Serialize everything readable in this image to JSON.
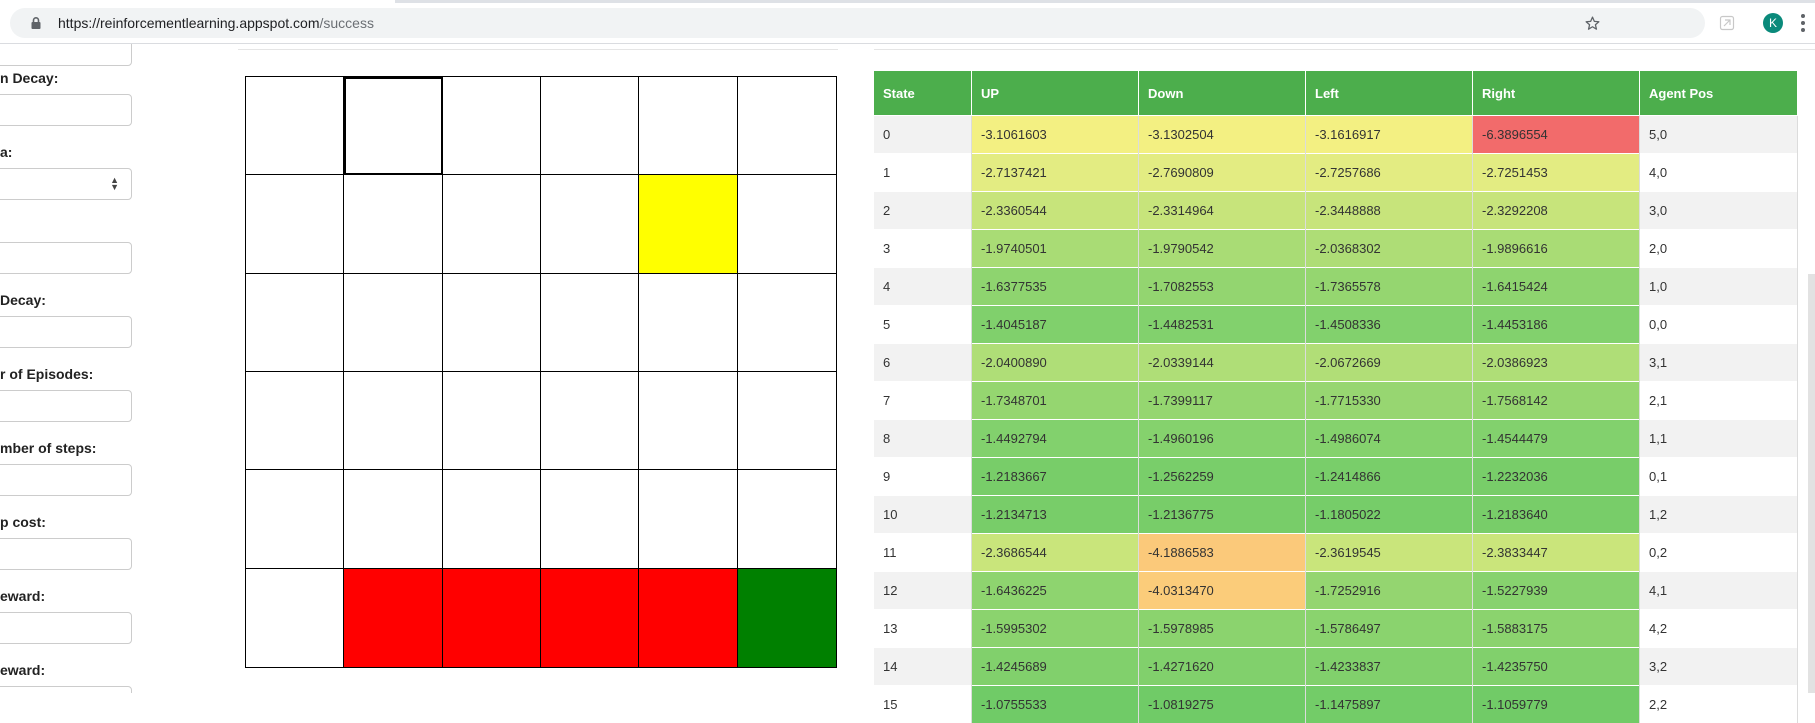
{
  "browser": {
    "url_host": "https://reinforcementlearning.appspot.com",
    "url_path": "/success",
    "profile_initial": "K"
  },
  "form": {
    "labels": [
      "n Decay:",
      "a:",
      "Decay:",
      "r of Episodes:",
      "mber of steps:",
      "p cost:",
      "eward:",
      "eward:"
    ]
  },
  "grid": {
    "rows": 6,
    "cols": 6,
    "current_cell": [
      0,
      1
    ],
    "colored_cells": [
      {
        "row": 1,
        "col": 4,
        "color": "#ffff00"
      },
      {
        "row": 5,
        "col": 1,
        "color": "#ff0000"
      },
      {
        "row": 5,
        "col": 2,
        "color": "#ff0000"
      },
      {
        "row": 5,
        "col": 3,
        "color": "#ff0000"
      },
      {
        "row": 5,
        "col": 4,
        "color": "#ff0000"
      },
      {
        "row": 5,
        "col": 5,
        "color": "#008000"
      }
    ]
  },
  "table": {
    "headers": [
      "State",
      "UP",
      "Down",
      "Left",
      "Right",
      "Agent Pos"
    ],
    "header_color": "#4cae4c",
    "rows": [
      {
        "state": "0",
        "q": [
          "-3.1061603",
          "-3.1302504",
          "-3.1616917",
          "-6.3896554"
        ],
        "colors": [
          "#f3f082",
          "#f3f082",
          "#f3f082",
          "#f26b6b"
        ],
        "pos": "5,0"
      },
      {
        "state": "1",
        "q": [
          "-2.7137421",
          "-2.7690809",
          "-2.7257686",
          "-2.7251453"
        ],
        "colors": [
          "#e3ec82",
          "#e3ec82",
          "#e3ec82",
          "#e3ec82"
        ],
        "pos": "4,0"
      },
      {
        "state": "2",
        "q": [
          "-2.3360544",
          "-2.3314964",
          "-2.3448888",
          "-2.3292208"
        ],
        "colors": [
          "#c7e47b",
          "#c7e47b",
          "#c7e47b",
          "#c7e47b"
        ],
        "pos": "3,0"
      },
      {
        "state": "3",
        "q": [
          "-1.9740501",
          "-1.9790542",
          "-2.0368302",
          "-1.9896616"
        ],
        "colors": [
          "#a9dc75",
          "#a9dc75",
          "#aedd76",
          "#a9dc75"
        ],
        "pos": "2,0"
      },
      {
        "state": "4",
        "q": [
          "-1.6377535",
          "-1.7082553",
          "-1.7365578",
          "-1.6415424"
        ],
        "colors": [
          "#8ed46f",
          "#93d570",
          "#95d670",
          "#8ed46f"
        ],
        "pos": "1,0"
      },
      {
        "state": "5",
        "q": [
          "-1.4045187",
          "-1.4482531",
          "-1.4508336",
          "-1.4453186"
        ],
        "colors": [
          "#80d06c",
          "#82d16d",
          "#82d16d",
          "#82d16d"
        ],
        "pos": "0,0"
      },
      {
        "state": "6",
        "q": [
          "-2.0400890",
          "-2.0339144",
          "-2.0672669",
          "-2.0386923"
        ],
        "colors": [
          "#afde77",
          "#afde77",
          "#b1de77",
          "#afde77"
        ],
        "pos": "3,1"
      },
      {
        "state": "7",
        "q": [
          "-1.7348701",
          "-1.7399117",
          "-1.7715330",
          "-1.7568142"
        ],
        "colors": [
          "#95d670",
          "#95d670",
          "#97d671",
          "#96d670"
        ],
        "pos": "2,1"
      },
      {
        "state": "8",
        "q": [
          "-1.4492794",
          "-1.4960196",
          "-1.4986074",
          "-1.4544479"
        ],
        "colors": [
          "#82d16d",
          "#85d26d",
          "#85d26d",
          "#82d16d"
        ],
        "pos": "1,1"
      },
      {
        "state": "9",
        "q": [
          "-1.2183667",
          "-1.2562259",
          "-1.2414866",
          "-1.2232036"
        ],
        "colors": [
          "#78cd69",
          "#79ce6a",
          "#79ce6a",
          "#78cd69"
        ],
        "pos": "0,1"
      },
      {
        "state": "10",
        "q": [
          "-1.2134713",
          "-1.2136775",
          "-1.1805022",
          "-1.2183640"
        ],
        "colors": [
          "#78cd69",
          "#78cd69",
          "#76cd69",
          "#78cd69"
        ],
        "pos": "1,2"
      },
      {
        "state": "11",
        "q": [
          "-2.3686544",
          "-4.1886583",
          "-2.3619545",
          "-2.3833447"
        ],
        "colors": [
          "#c9e57b",
          "#fbc97a",
          "#c9e57b",
          "#cae57b"
        ],
        "pos": "0,2"
      },
      {
        "state": "12",
        "q": [
          "-1.6436225",
          "-4.0313470",
          "-1.7252916",
          "-1.5227939"
        ],
        "colors": [
          "#8ed46f",
          "#fbcc7a",
          "#94d570",
          "#87d26e"
        ],
        "pos": "4,1"
      },
      {
        "state": "13",
        "q": [
          "-1.5995302",
          "-1.5978985",
          "-1.5786497",
          "-1.5883175"
        ],
        "colors": [
          "#8bd36e",
          "#8bd36e",
          "#8ad36e",
          "#8bd36e"
        ],
        "pos": "4,2"
      },
      {
        "state": "14",
        "q": [
          "-1.4245689",
          "-1.4271620",
          "-1.4233837",
          "-1.4235750"
        ],
        "colors": [
          "#81d06c",
          "#81d06c",
          "#81d06c",
          "#81d06c"
        ],
        "pos": "3,2"
      },
      {
        "state": "15",
        "q": [
          "-1.0755533",
          "-1.0819275",
          "-1.1475897",
          "-1.1059779"
        ],
        "colors": [
          "#70cb67",
          "#70cb67",
          "#73cc68",
          "#71cb67"
        ],
        "pos": "2,2"
      }
    ]
  }
}
